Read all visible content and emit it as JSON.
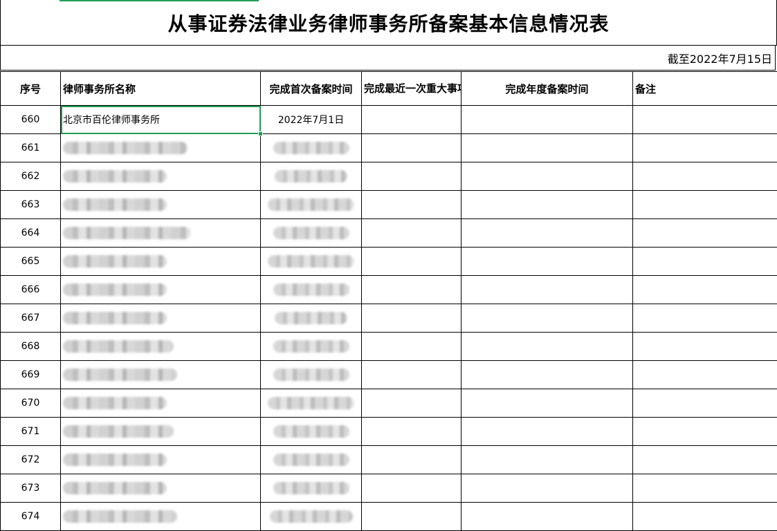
{
  "sheet": {
    "title": "从事证券法律业务律师事务所备案基本信息情况表",
    "as_of": "截至2022年7月15日",
    "columns": {
      "seq": "序号",
      "name": "律师事务所名称",
      "first_filing": "完成首次备案时间",
      "major_filing": "完成最近一次重大事项备案时间",
      "annual_filing": "完成年度备案时间",
      "remark": "备注"
    },
    "rows": [
      {
        "seq": "660",
        "name": "北京市百伦律师事务所",
        "first_filing": "2022年7月1日",
        "redacted": false
      },
      {
        "seq": "661",
        "redacted": true
      },
      {
        "seq": "662",
        "redacted": true
      },
      {
        "seq": "663",
        "redacted": true
      },
      {
        "seq": "664",
        "redacted": true
      },
      {
        "seq": "665",
        "redacted": true
      },
      {
        "seq": "666",
        "redacted": true
      },
      {
        "seq": "667",
        "redacted": true
      },
      {
        "seq": "668",
        "redacted": true
      },
      {
        "seq": "669",
        "redacted": true
      },
      {
        "seq": "670",
        "redacted": true
      },
      {
        "seq": "671",
        "redacted": true
      },
      {
        "seq": "672",
        "redacted": true
      },
      {
        "seq": "673",
        "redacted": true
      },
      {
        "seq": "674",
        "redacted": true
      }
    ],
    "colors": {
      "selection": "#1f9d55",
      "grid": "#000000"
    }
  }
}
